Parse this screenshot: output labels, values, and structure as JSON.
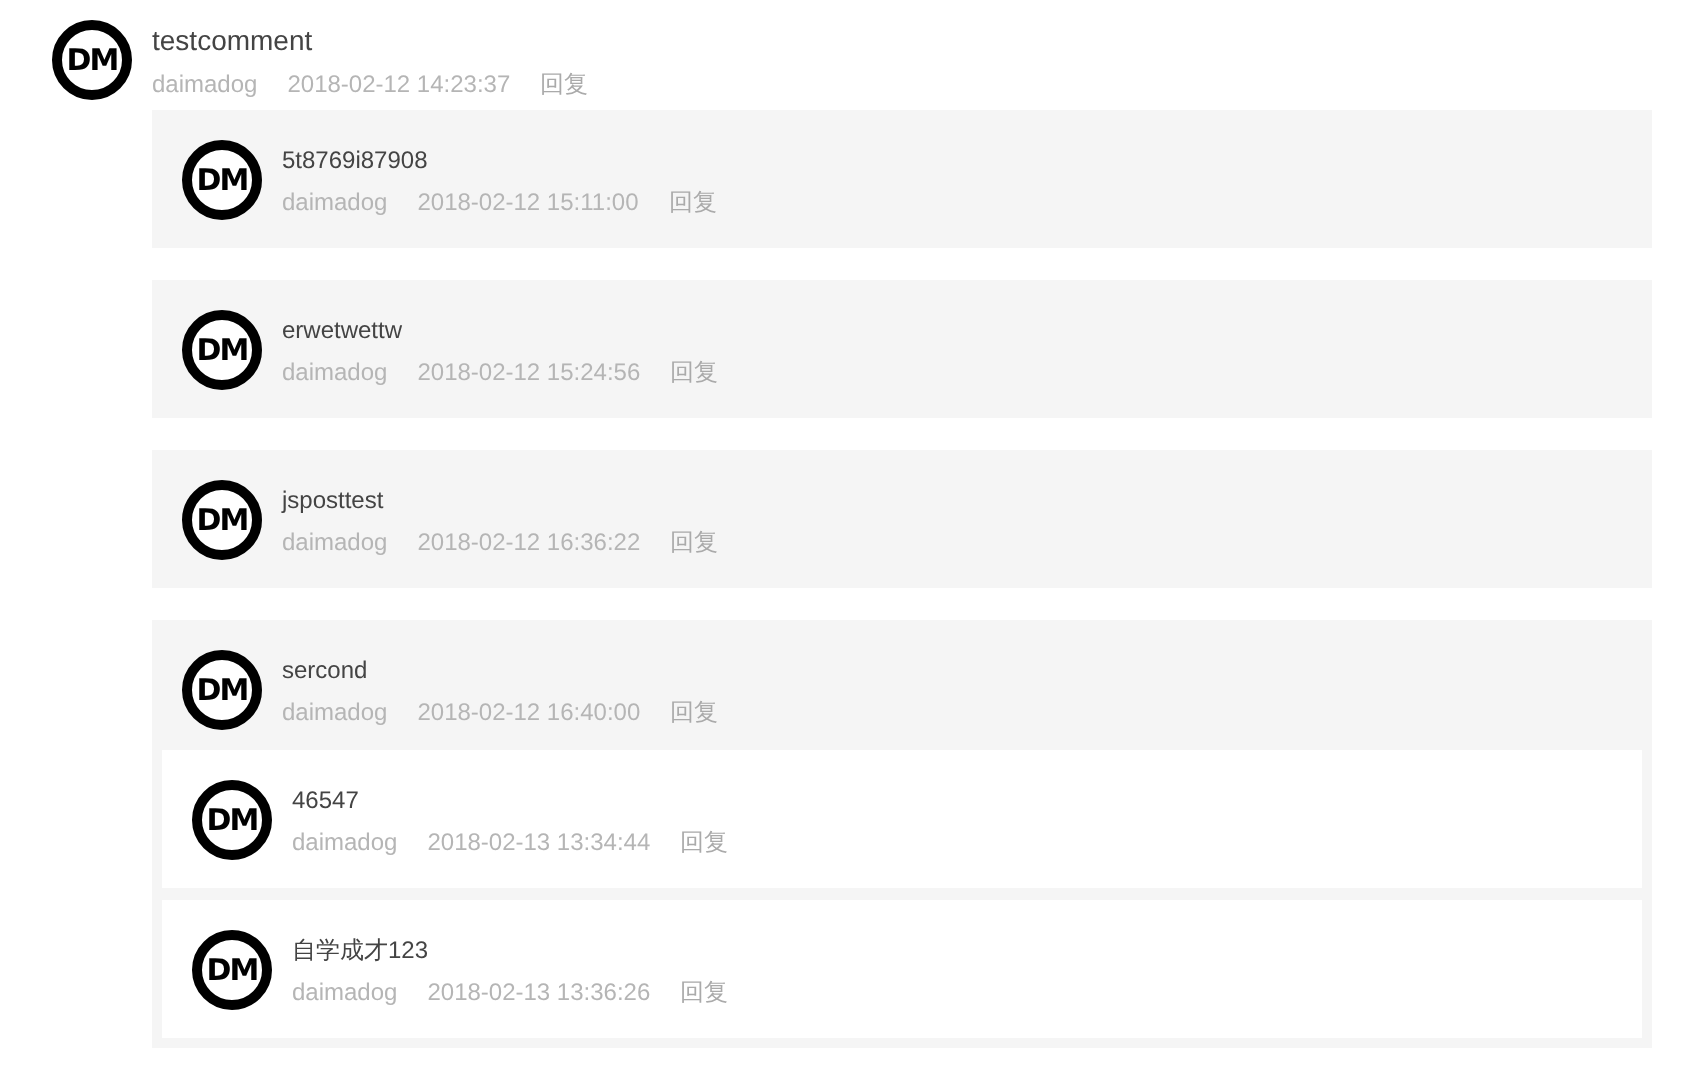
{
  "comment": {
    "avatar_text": "DM",
    "text": "testcomment",
    "author": "daimadog",
    "time": "2018-02-12 14:23:37",
    "reply_label": "回复",
    "replies": [
      {
        "avatar_text": "DM",
        "text": "5t8769i87908",
        "author": "daimadog",
        "time": "2018-02-12 15:11:00",
        "reply_label": "回复"
      },
      {
        "avatar_text": "DM",
        "text": "erwetwettw",
        "author": "daimadog",
        "time": "2018-02-12 15:24:56",
        "reply_label": "回复"
      },
      {
        "avatar_text": "DM",
        "text": "jsposttest",
        "author": "daimadog",
        "time": "2018-02-12 16:36:22",
        "reply_label": "回复"
      },
      {
        "avatar_text": "DM",
        "text": "sercond",
        "author": "daimadog",
        "time": "2018-02-12 16:40:00",
        "reply_label": "回复",
        "children": [
          {
            "avatar_text": "DM",
            "text": "46547",
            "author": "daimadog",
            "time": "2018-02-13 13:34:44",
            "reply_label": "回复"
          },
          {
            "avatar_text": "DM",
            "text": "自学成才123",
            "author": "daimadog",
            "time": "2018-02-13 13:36:26",
            "reply_label": "回复"
          }
        ]
      }
    ]
  }
}
